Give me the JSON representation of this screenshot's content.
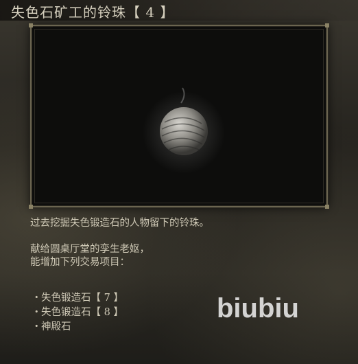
{
  "title": "失色石矿工的铃珠【 4 】",
  "description": {
    "lines": [
      "过去挖掘失色锻造石的人物留下的铃珠。",
      "",
      "献给圆桌厅堂的孪生老妪，",
      "能增加下列交易项目："
    ]
  },
  "trade_items": [
    "失色锻造石【 7 】",
    "失色锻造石【 8 】",
    "神殿石"
  ],
  "bullet": "・",
  "watermark": "biubiu",
  "colors": {
    "text": "#cfc9b6",
    "title": "#d8d2c0",
    "frame_border": "#6b6550"
  }
}
